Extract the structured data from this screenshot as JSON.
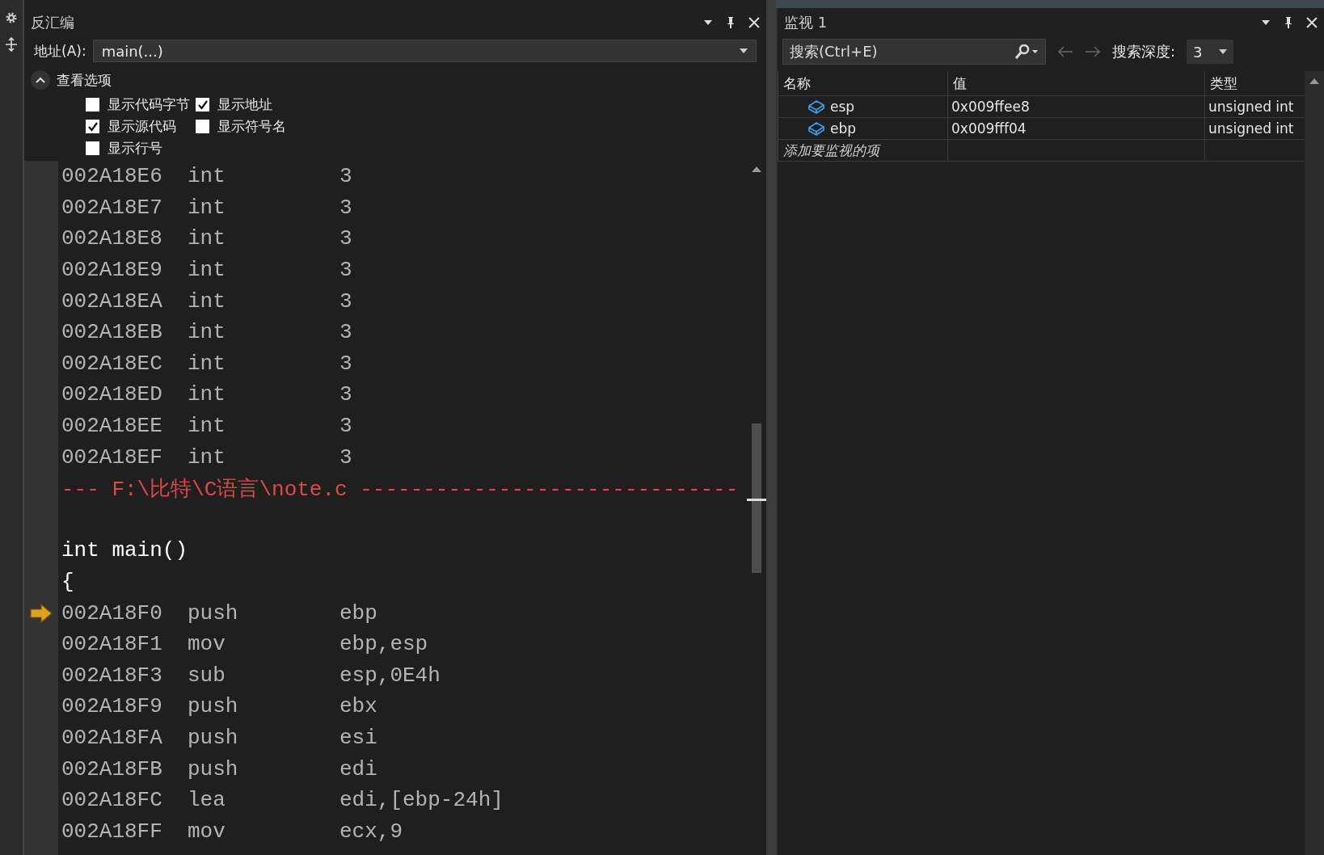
{
  "disassembly": {
    "title": "反汇编",
    "address_label": "地址(A):",
    "address_value": "main(...)",
    "options_title": "查看选项",
    "options_expanded": true,
    "options": [
      {
        "label": "显示代码字节",
        "checked": false
      },
      {
        "label": "显示地址",
        "checked": true
      },
      {
        "label": "显示源代码",
        "checked": true
      },
      {
        "label": "显示符号名",
        "checked": false
      },
      {
        "label": "显示行号",
        "checked": false
      }
    ],
    "lines": [
      {
        "kind": "instr",
        "address": "002A18E6",
        "mnemonic": "int",
        "operand": "3",
        "current": false
      },
      {
        "kind": "instr",
        "address": "002A18E7",
        "mnemonic": "int",
        "operand": "3",
        "current": false
      },
      {
        "kind": "instr",
        "address": "002A18E8",
        "mnemonic": "int",
        "operand": "3",
        "current": false
      },
      {
        "kind": "instr",
        "address": "002A18E9",
        "mnemonic": "int",
        "operand": "3",
        "current": false
      },
      {
        "kind": "instr",
        "address": "002A18EA",
        "mnemonic": "int",
        "operand": "3",
        "current": false
      },
      {
        "kind": "instr",
        "address": "002A18EB",
        "mnemonic": "int",
        "operand": "3",
        "current": false
      },
      {
        "kind": "instr",
        "address": "002A18EC",
        "mnemonic": "int",
        "operand": "3",
        "current": false
      },
      {
        "kind": "instr",
        "address": "002A18ED",
        "mnemonic": "int",
        "operand": "3",
        "current": false
      },
      {
        "kind": "instr",
        "address": "002A18EE",
        "mnemonic": "int",
        "operand": "3",
        "current": false
      },
      {
        "kind": "instr",
        "address": "002A18EF",
        "mnemonic": "int",
        "operand": "3",
        "current": false
      },
      {
        "kind": "file",
        "text": "--- F:\\比特\\C语言\\note.c ------------------------------"
      },
      {
        "kind": "blank"
      },
      {
        "kind": "source",
        "text": "int main()"
      },
      {
        "kind": "source",
        "text": "{"
      },
      {
        "kind": "instr",
        "address": "002A18F0",
        "mnemonic": "push",
        "operand": "ebp",
        "current": true
      },
      {
        "kind": "instr",
        "address": "002A18F1",
        "mnemonic": "mov",
        "operand": "ebp,esp",
        "current": false
      },
      {
        "kind": "instr",
        "address": "002A18F3",
        "mnemonic": "sub",
        "operand": "esp,0E4h",
        "current": false
      },
      {
        "kind": "instr",
        "address": "002A18F9",
        "mnemonic": "push",
        "operand": "ebx",
        "current": false
      },
      {
        "kind": "instr",
        "address": "002A18FA",
        "mnemonic": "push",
        "operand": "esi",
        "current": false
      },
      {
        "kind": "instr",
        "address": "002A18FB",
        "mnemonic": "push",
        "operand": "edi",
        "current": false
      },
      {
        "kind": "instr",
        "address": "002A18FC",
        "mnemonic": "lea",
        "operand": "edi,[ebp-24h]",
        "current": false
      },
      {
        "kind": "instr",
        "address": "002A18FF",
        "mnemonic": "mov",
        "operand": "ecx,9",
        "current": false
      }
    ]
  },
  "watch": {
    "title": "监视 1",
    "search_placeholder": "搜索(Ctrl+E)",
    "depth_label": "搜索深度:",
    "depth_value": "3",
    "columns": [
      "名称",
      "值",
      "类型"
    ],
    "rows": [
      {
        "name": "esp",
        "value": "0x009ffee8",
        "type": "unsigned int"
      },
      {
        "name": "ebp",
        "value": "0x009fff04",
        "type": "unsigned int"
      }
    ],
    "add_item": "添加要监视的项"
  }
}
